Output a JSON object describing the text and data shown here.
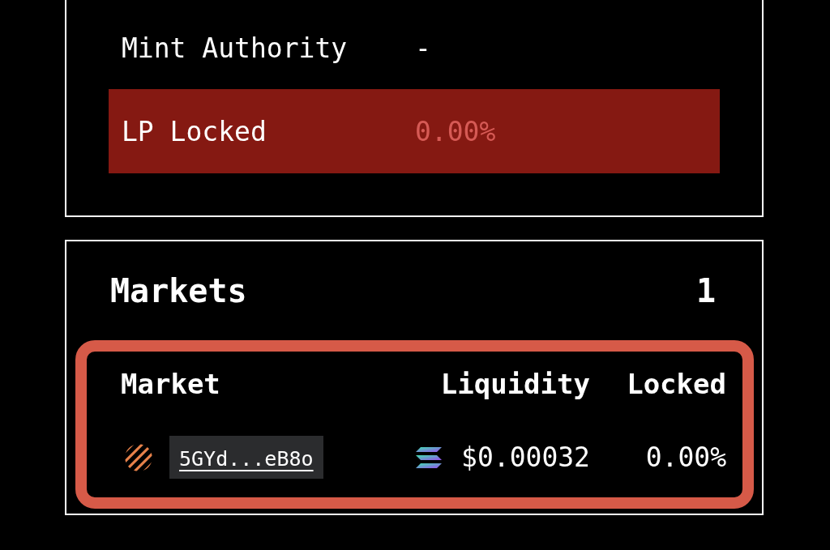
{
  "token_info": {
    "rows": [
      {
        "label": "Mint Authority",
        "value": "-",
        "warning": false
      },
      {
        "label": "LP Locked",
        "value": "0.00%",
        "warning": true
      }
    ]
  },
  "markets": {
    "title": "Markets",
    "count": "1",
    "highlighted": true,
    "table": {
      "columns": [
        "Market",
        "Liquidity",
        "Locked"
      ],
      "rows": [
        {
          "market": "5GYd...eB8o",
          "liquidity": "$0.00032",
          "locked": "0.00%"
        }
      ]
    }
  }
}
